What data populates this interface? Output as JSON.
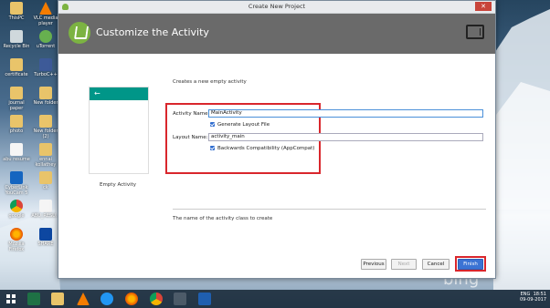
{
  "window": {
    "title": "Create New Project",
    "header_title": "Customize the Activity"
  },
  "desktop_icons": [
    {
      "label": "ThisPC",
      "glyph": "folder"
    },
    {
      "label": "VLC media player",
      "glyph": "vlc"
    },
    {
      "label": "Recycle Bin",
      "glyph": "bin"
    },
    {
      "label": "uTorrent",
      "glyph": "utorrent"
    },
    {
      "label": "certificate",
      "glyph": "folder"
    },
    {
      "label": "TurboC++",
      "glyph": "turbo"
    },
    {
      "label": "journal paper",
      "glyph": "folder"
    },
    {
      "label": "New folder",
      "glyph": "folder"
    },
    {
      "label": "photo",
      "glyph": "folder"
    },
    {
      "label": "New folder (2)",
      "glyph": "folder"
    },
    {
      "label": "abu resume",
      "glyph": "file"
    },
    {
      "label": "ennai kollathey",
      "glyph": "folder"
    },
    {
      "label": "CyberLink YouCam 5",
      "glyph": "cyber"
    },
    {
      "label": "ck",
      "glyph": "folder"
    },
    {
      "label": "google",
      "glyph": "chrome"
    },
    {
      "label": "ABU_RESU...",
      "glyph": "file"
    },
    {
      "label": "Mozilla Firefox",
      "glyph": "firefox"
    },
    {
      "label": "SHARE",
      "glyph": "share"
    }
  ],
  "template": {
    "description": "Creates a new empty activity",
    "preview_label": "Empty Activity",
    "preview_back_glyph": "←"
  },
  "form": {
    "activity_name_label": "Activity Name:",
    "activity_name_value": "MainActivity",
    "generate_layout_label": "Generate Layout File",
    "layout_name_label": "Layout Name:",
    "layout_name_value": "activity_main",
    "backwards_compat_label": "Backwards Compatibility (AppCompat)"
  },
  "help_text": "The name of the activity class to create",
  "buttons": {
    "previous": "Previous",
    "next": "Next",
    "cancel": "Cancel",
    "finish": "Finish"
  },
  "taskbar": {
    "tray_lang": "ENG",
    "tray_time": "18:51",
    "tray_date": "09-09-2017"
  },
  "wallpaper_brand": "bing",
  "colors": {
    "accent": "#3b73d4",
    "highlight": "#d9262c",
    "header": "#6a6a6a",
    "preview_bar": "#009688"
  }
}
